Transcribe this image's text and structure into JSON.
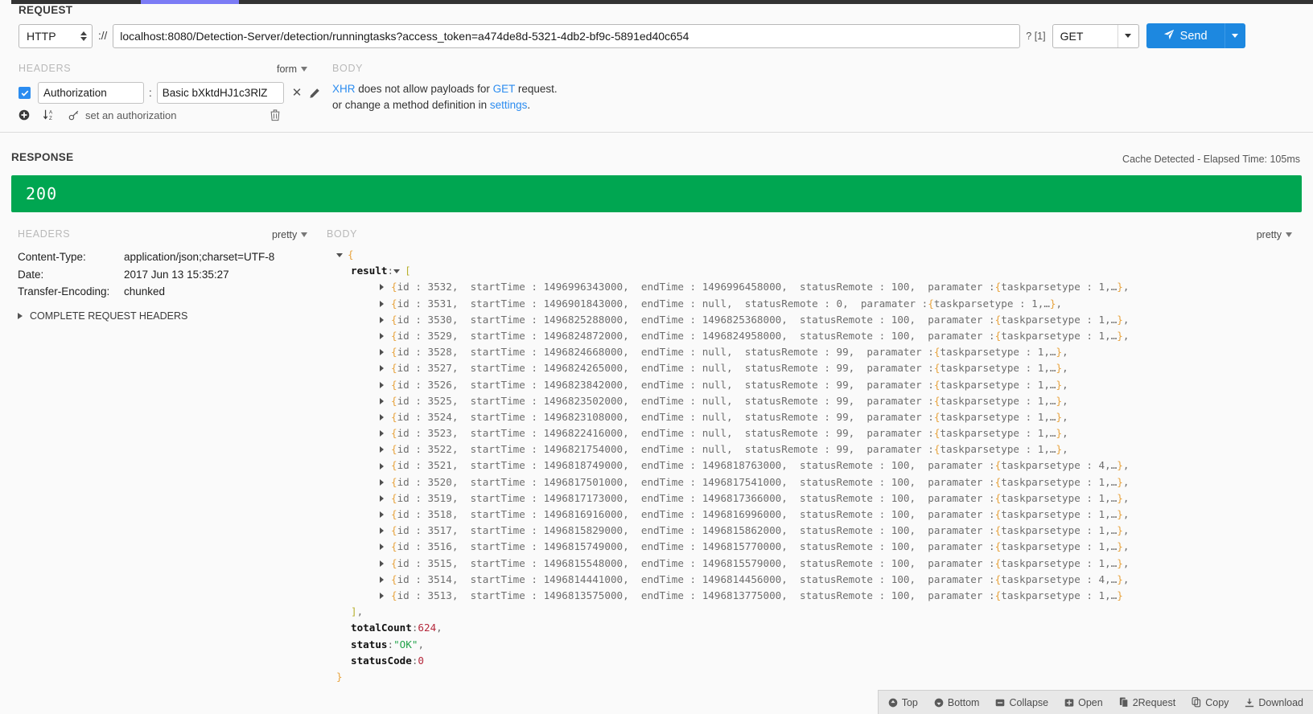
{
  "request": {
    "title": "REQUEST",
    "protocol": "HTTP",
    "protocol_separator": "://",
    "url": "localhost:8080/Detection-Server/detection/runningtasks?access_token=a474de8d-5321-4db2-bf9c-5891ed40c654",
    "query_count": "? [1]",
    "method": "GET",
    "send_label": "Send",
    "headers_label": "HEADERS",
    "headers_mode": "form",
    "body_label": "BODY",
    "header_rows": [
      {
        "enabled": true,
        "key": "Authorization",
        "value": "Basic bXktdHJ1c3RlZ"
      }
    ],
    "set_authorization_label": "set an authorization",
    "body_note_line1_pre": "XHR",
    "body_note_line1_mid": " does not allow payloads for ",
    "body_note_line1_method": "GET",
    "body_note_line1_post": " request.",
    "body_note_line2_pre": "or change a method definition in ",
    "body_note_line2_link": "settings",
    "body_note_line2_post": "."
  },
  "response": {
    "title": "RESPONSE",
    "meta": "Cache Detected - Elapsed Time: 105ms",
    "status_code": "200",
    "headers_label": "HEADERS",
    "headers_mode": "pretty",
    "body_label": "BODY",
    "body_mode": "pretty",
    "headers": [
      {
        "name": "Content-Type:",
        "value": "application/json;charset=UTF-8"
      },
      {
        "name": "Date:",
        "value": "2017 Jun 13 15:35:27"
      },
      {
        "name": "Transfer-Encoding:",
        "value": "chunked"
      }
    ],
    "complete_request_headers_label": "COMPLETE REQUEST HEADERS"
  },
  "json_body": {
    "root_open": "{",
    "root_close": "}",
    "result_key": "result",
    "result_open": "[",
    "result_close": "],",
    "rows": [
      {
        "id": "3532",
        "startTime": "1496996343000",
        "endTime": "1496996458000",
        "statusRemote": "100",
        "taskparsetype": "1",
        "trailing": ","
      },
      {
        "id": "3531",
        "startTime": "1496901843000",
        "endTime": "null",
        "statusRemote": "0",
        "taskparsetype": "1",
        "trailing": ","
      },
      {
        "id": "3530",
        "startTime": "1496825288000",
        "endTime": "1496825368000",
        "statusRemote": "100",
        "taskparsetype": "1",
        "trailing": ","
      },
      {
        "id": "3529",
        "startTime": "1496824872000",
        "endTime": "1496824958000",
        "statusRemote": "100",
        "taskparsetype": "1",
        "trailing": ","
      },
      {
        "id": "3528",
        "startTime": "1496824668000",
        "endTime": "null",
        "statusRemote": "99",
        "taskparsetype": "1",
        "trailing": ","
      },
      {
        "id": "3527",
        "startTime": "1496824265000",
        "endTime": "null",
        "statusRemote": "99",
        "taskparsetype": "1",
        "trailing": ","
      },
      {
        "id": "3526",
        "startTime": "1496823842000",
        "endTime": "null",
        "statusRemote": "99",
        "taskparsetype": "1",
        "trailing": ","
      },
      {
        "id": "3525",
        "startTime": "1496823502000",
        "endTime": "null",
        "statusRemote": "99",
        "taskparsetype": "1",
        "trailing": ","
      },
      {
        "id": "3524",
        "startTime": "1496823108000",
        "endTime": "null",
        "statusRemote": "99",
        "taskparsetype": "1",
        "trailing": ","
      },
      {
        "id": "3523",
        "startTime": "1496822416000",
        "endTime": "null",
        "statusRemote": "99",
        "taskparsetype": "1",
        "trailing": ","
      },
      {
        "id": "3522",
        "startTime": "1496821754000",
        "endTime": "null",
        "statusRemote": "99",
        "taskparsetype": "1",
        "trailing": ","
      },
      {
        "id": "3521",
        "startTime": "1496818749000",
        "endTime": "1496818763000",
        "statusRemote": "100",
        "taskparsetype": "4",
        "trailing": ","
      },
      {
        "id": "3520",
        "startTime": "1496817501000",
        "endTime": "1496817541000",
        "statusRemote": "100",
        "taskparsetype": "1",
        "trailing": ","
      },
      {
        "id": "3519",
        "startTime": "1496817173000",
        "endTime": "1496817366000",
        "statusRemote": "100",
        "taskparsetype": "1",
        "trailing": ","
      },
      {
        "id": "3518",
        "startTime": "1496816916000",
        "endTime": "1496816996000",
        "statusRemote": "100",
        "taskparsetype": "1",
        "trailing": ","
      },
      {
        "id": "3517",
        "startTime": "1496815829000",
        "endTime": "1496815862000",
        "statusRemote": "100",
        "taskparsetype": "1",
        "trailing": ","
      },
      {
        "id": "3516",
        "startTime": "1496815749000",
        "endTime": "1496815770000",
        "statusRemote": "100",
        "taskparsetype": "1",
        "trailing": ","
      },
      {
        "id": "3515",
        "startTime": "1496815548000",
        "endTime": "1496815579000",
        "statusRemote": "100",
        "taskparsetype": "1",
        "trailing": ","
      },
      {
        "id": "3514",
        "startTime": "1496814441000",
        "endTime": "1496814456000",
        "statusRemote": "100",
        "taskparsetype": "4",
        "trailing": ","
      },
      {
        "id": "3513",
        "startTime": "1496813575000",
        "endTime": "1496813775000",
        "statusRemote": "100",
        "taskparsetype": "1",
        "trailing": ""
      }
    ],
    "labels": {
      "id": "id",
      "startTime": "startTime",
      "endTime": "endTime",
      "statusRemote": "statusRemote",
      "paramater": "paramater",
      "taskparsetype": "taskparsetype",
      "ellipsis": ",…"
    },
    "totals": [
      {
        "key": "totalCount",
        "value": "624",
        "type": "num",
        "comma": ","
      },
      {
        "key": "status",
        "value": "\"OK\"",
        "type": "str",
        "comma": ","
      },
      {
        "key": "statusCode",
        "value": "0",
        "type": "num",
        "comma": ""
      }
    ]
  },
  "json_toolbar": [
    {
      "label": "Top",
      "icon": "arrow-up-circle-icon"
    },
    {
      "label": "Bottom",
      "icon": "arrow-down-circle-icon"
    },
    {
      "label": "Collapse",
      "icon": "minus-square-icon"
    },
    {
      "label": "Open",
      "icon": "plus-square-icon"
    },
    {
      "label": "2Request",
      "icon": "copy-to-request-icon"
    },
    {
      "label": "Copy",
      "icon": "copy-icon"
    },
    {
      "label": "Download",
      "icon": "download-icon"
    }
  ],
  "colors": {
    "accent_blue": "#1d88e0",
    "status_green": "#00a651",
    "tab_indicator": "#7b7bf5",
    "json_brace": "#e8a33d",
    "json_bracket": "#b8b02e",
    "json_string": "#22a34a",
    "json_number": "#b5293c"
  }
}
